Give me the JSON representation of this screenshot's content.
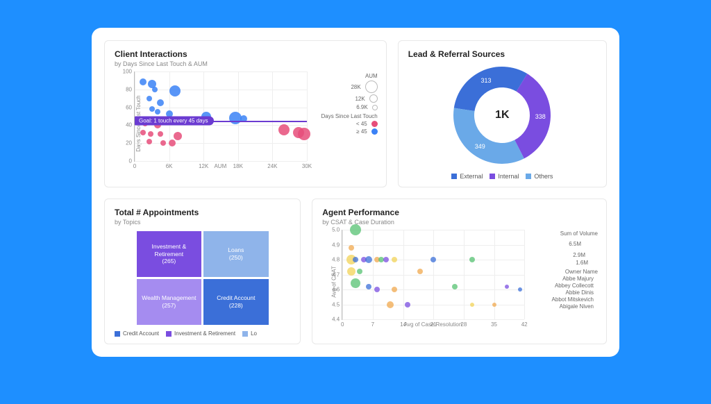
{
  "interactions": {
    "title": "Client Interactions",
    "subtitle": "by Days Since Last Touch & AUM",
    "ylabel": "Days Since Last Touch",
    "xlabel": "AUM",
    "goal_label": "Goal: 1 touch every 45 days",
    "legend_title_size": "AUM",
    "legend_title_color": "Days Since Last Touch",
    "size_legend": [
      {
        "label": "28K",
        "d": 18
      },
      {
        "label": "12K",
        "d": 12
      },
      {
        "label": "6.9K",
        "d": 8
      }
    ],
    "color_legend": [
      {
        "label": "< 45",
        "color": "#e64d7a"
      },
      {
        "label": "≥ 45",
        "color": "#3b82f6"
      }
    ]
  },
  "sources": {
    "title": "Lead & Referral Sources",
    "center_label": "1K",
    "slices": [
      {
        "name": "External",
        "value": 313,
        "color": "#3b6fd8"
      },
      {
        "name": "Internal",
        "value": 338,
        "color": "#7a4de0"
      },
      {
        "name": "Others",
        "value": 349,
        "color": "#6aa9e8"
      }
    ]
  },
  "appointments": {
    "title": "Total # Appointments",
    "subtitle": "by Topics",
    "tiles": [
      {
        "label": "Investment & Retirement",
        "count": "(265)",
        "color": "#7a4de0"
      },
      {
        "label": "Loans",
        "count": "(250)",
        "color": "#8fb4ea"
      },
      {
        "label": "Wealth Management",
        "count": "(257)",
        "color": "#a58cf0"
      },
      {
        "label": "Credit Account",
        "count": "(228)",
        "color": "#3b6fd8"
      }
    ],
    "legend": [
      "Credit Account",
      "Investment & Retirement",
      "Lo"
    ]
  },
  "performance": {
    "title": "Agent Performance",
    "subtitle": "by CSAT & Case Duration",
    "ylabel": "Avg of CSAT",
    "xlabel": "Avg of Case Resolution",
    "size_title": "Sum of Volume",
    "size_legend": [
      {
        "label": "6.5M",
        "d": 18
      },
      {
        "label": "2.9M",
        "d": 12
      },
      {
        "label": "1.6M",
        "d": 8
      }
    ],
    "owner_title": "Owner Name",
    "owners": [
      {
        "name": "Abbe Majury",
        "color": "#3b6fd8"
      },
      {
        "name": "Abbey Collecott",
        "color": "#7a4de0"
      },
      {
        "name": "Abbie Dinis",
        "color": "#56c271"
      },
      {
        "name": "Abbot Mitskevich",
        "color": "#f2d357"
      },
      {
        "name": "Abigale Niven",
        "color": "#f0a84e"
      }
    ]
  },
  "chart_data": [
    {
      "id": "client_interactions",
      "type": "scatter",
      "title": "Client Interactions",
      "xlabel": "AUM",
      "ylabel": "Days Since Last Touch",
      "xlim": [
        0,
        30000
      ],
      "ylim": [
        0,
        100
      ],
      "xticks": [
        0,
        6000,
        12000,
        18000,
        24000,
        30000
      ],
      "yticks": [
        0,
        20,
        40,
        60,
        80,
        100
      ],
      "size_encodes": "AUM",
      "color_encodes": "Days Since Last Touch (< 45 pink, ≥ 45 blue)",
      "reference_line": {
        "y": 45,
        "label": "Goal: 1 touch every 45 days"
      },
      "points": [
        {
          "x": 1500,
          "y": 88,
          "size": 10,
          "group": ">=45"
        },
        {
          "x": 3000,
          "y": 86,
          "size": 12,
          "group": ">=45"
        },
        {
          "x": 3500,
          "y": 80,
          "size": 8,
          "group": ">=45"
        },
        {
          "x": 7000,
          "y": 78,
          "size": 16,
          "group": ">=45"
        },
        {
          "x": 2500,
          "y": 70,
          "size": 8,
          "group": ">=45"
        },
        {
          "x": 4500,
          "y": 65,
          "size": 10,
          "group": ">=45"
        },
        {
          "x": 3000,
          "y": 58,
          "size": 8,
          "group": ">=45"
        },
        {
          "x": 4000,
          "y": 55,
          "size": 8,
          "group": ">=45"
        },
        {
          "x": 6000,
          "y": 53,
          "size": 10,
          "group": ">=45"
        },
        {
          "x": 12500,
          "y": 50,
          "size": 14,
          "group": ">=45"
        },
        {
          "x": 17500,
          "y": 48,
          "size": 18,
          "group": ">=45"
        },
        {
          "x": 19000,
          "y": 47,
          "size": 10,
          "group": ">=45"
        },
        {
          "x": 1800,
          "y": 42,
          "size": 8,
          "group": "<45"
        },
        {
          "x": 4000,
          "y": 40,
          "size": 10,
          "group": "<45"
        },
        {
          "x": 1500,
          "y": 32,
          "size": 8,
          "group": "<45"
        },
        {
          "x": 2800,
          "y": 30,
          "size": 8,
          "group": "<45"
        },
        {
          "x": 4500,
          "y": 30,
          "size": 8,
          "group": "<45"
        },
        {
          "x": 7500,
          "y": 28,
          "size": 12,
          "group": "<45"
        },
        {
          "x": 2500,
          "y": 22,
          "size": 8,
          "group": "<45"
        },
        {
          "x": 5000,
          "y": 20,
          "size": 8,
          "group": "<45"
        },
        {
          "x": 6500,
          "y": 20,
          "size": 10,
          "group": "<45"
        },
        {
          "x": 26000,
          "y": 35,
          "size": 16,
          "group": "<45"
        },
        {
          "x": 28500,
          "y": 32,
          "size": 16,
          "group": "<45"
        },
        {
          "x": 29500,
          "y": 30,
          "size": 18,
          "group": "<45"
        }
      ]
    },
    {
      "id": "lead_referral_sources",
      "type": "pie",
      "title": "Lead & Referral Sources",
      "donut": true,
      "center_label": "1K",
      "series": [
        {
          "name": "External",
          "value": 313
        },
        {
          "name": "Internal",
          "value": 338
        },
        {
          "name": "Others",
          "value": 349
        }
      ]
    },
    {
      "id": "total_appointments",
      "type": "treemap",
      "title": "Total # Appointments",
      "series": [
        {
          "name": "Investment & Retirement",
          "value": 265
        },
        {
          "name": "Wealth Management",
          "value": 257
        },
        {
          "name": "Loans",
          "value": 250
        },
        {
          "name": "Credit Account",
          "value": 228
        }
      ]
    },
    {
      "id": "agent_performance",
      "type": "scatter",
      "title": "Agent Performance",
      "xlabel": "Avg of Case Resolution",
      "ylabel": "Avg of CSAT",
      "xlim": [
        0,
        42
      ],
      "ylim": [
        4.4,
        5.0
      ],
      "xticks": [
        0,
        7,
        14,
        21,
        28,
        35,
        42
      ],
      "yticks": [
        4.4,
        4.5,
        4.6,
        4.7,
        4.8,
        4.9,
        5.0
      ],
      "size_encodes": "Sum of Volume",
      "color_encodes": "Owner Name",
      "points": [
        {
          "x": 3,
          "y": 5.0,
          "size": 16,
          "owner": "Abbie Dinis"
        },
        {
          "x": 2,
          "y": 4.88,
          "size": 8,
          "owner": "Abigale Niven"
        },
        {
          "x": 2,
          "y": 4.8,
          "size": 14,
          "owner": "Abbot Mitskevich"
        },
        {
          "x": 3,
          "y": 4.8,
          "size": 8,
          "owner": "Abbe Majury"
        },
        {
          "x": 5,
          "y": 4.8,
          "size": 8,
          "owner": "Abbey Collecott"
        },
        {
          "x": 6,
          "y": 4.8,
          "size": 10,
          "owner": "Abbe Majury"
        },
        {
          "x": 8,
          "y": 4.8,
          "size": 8,
          "owner": "Abigale Niven"
        },
        {
          "x": 9,
          "y": 4.8,
          "size": 8,
          "owner": "Abbie Dinis"
        },
        {
          "x": 10,
          "y": 4.8,
          "size": 8,
          "owner": "Abbey Collecott"
        },
        {
          "x": 12,
          "y": 4.8,
          "size": 8,
          "owner": "Abbot Mitskevich"
        },
        {
          "x": 21,
          "y": 4.8,
          "size": 8,
          "owner": "Abbe Majury"
        },
        {
          "x": 30,
          "y": 4.8,
          "size": 8,
          "owner": "Abbie Dinis"
        },
        {
          "x": 2,
          "y": 4.72,
          "size": 12,
          "owner": "Abbot Mitskevich"
        },
        {
          "x": 4,
          "y": 4.72,
          "size": 8,
          "owner": "Abbie Dinis"
        },
        {
          "x": 18,
          "y": 4.72,
          "size": 8,
          "owner": "Abigale Niven"
        },
        {
          "x": 3,
          "y": 4.64,
          "size": 14,
          "owner": "Abbie Dinis"
        },
        {
          "x": 6,
          "y": 4.62,
          "size": 8,
          "owner": "Abbe Majury"
        },
        {
          "x": 8,
          "y": 4.6,
          "size": 8,
          "owner": "Abbey Collecott"
        },
        {
          "x": 12,
          "y": 4.6,
          "size": 8,
          "owner": "Abigale Niven"
        },
        {
          "x": 26,
          "y": 4.62,
          "size": 8,
          "owner": "Abbie Dinis"
        },
        {
          "x": 38,
          "y": 4.62,
          "size": 6,
          "owner": "Abbey Collecott"
        },
        {
          "x": 41,
          "y": 4.6,
          "size": 6,
          "owner": "Abbe Majury"
        },
        {
          "x": 11,
          "y": 4.5,
          "size": 10,
          "owner": "Abigale Niven"
        },
        {
          "x": 15,
          "y": 4.5,
          "size": 8,
          "owner": "Abbey Collecott"
        },
        {
          "x": 30,
          "y": 4.5,
          "size": 6,
          "owner": "Abbot Mitskevich"
        },
        {
          "x": 35,
          "y": 4.5,
          "size": 6,
          "owner": "Abigale Niven"
        }
      ]
    }
  ]
}
